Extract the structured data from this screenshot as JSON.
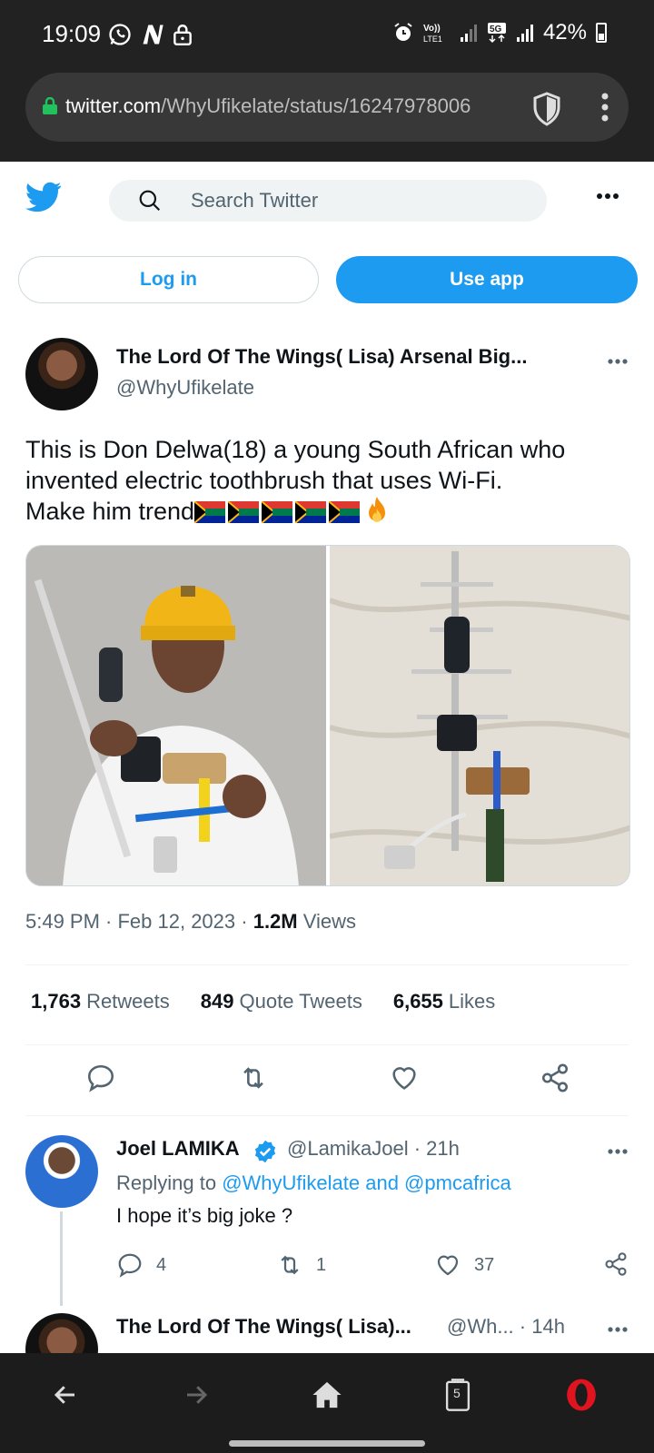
{
  "status_bar": {
    "time": "19:09",
    "battery": "42%",
    "network": "5G"
  },
  "browser": {
    "url_domain": "twitter.com",
    "url_path": "/WhyUfikelate/status/16247978006"
  },
  "header": {
    "search_placeholder": "Search Twitter"
  },
  "auth": {
    "login_label": "Log in",
    "use_app_label": "Use app"
  },
  "tweet": {
    "author_name": "The Lord Of The Wings( Lisa) Arsenal Big...",
    "author_handle": "@WhyUfikelate",
    "text_line1": "This is Don Delwa(18) a young South African who",
    "text_line2": "invented electric toothbrush that uses Wi-Fi.",
    "text_line3": "Make him trend",
    "time": "5:49 PM · Feb 12, 2023 · ",
    "views_count": "1.2M",
    "views_label": " Views",
    "retweets_count": "1,763",
    "retweets_label": "Retweets",
    "quotes_count": "849",
    "quotes_label": "Quote Tweets",
    "likes_count": "6,655",
    "likes_label": "Likes"
  },
  "reply": {
    "name": "Joel LAMIKA",
    "handle_time": "@LamikaJoel · 21h",
    "replying_prefix": "Replying to ",
    "replying_to": "@WhyUfikelate and @pmcafrica",
    "text": "I hope it’s big joke ?",
    "reply_count": "4",
    "retweet_count": "1",
    "like_count": "37"
  },
  "reply2": {
    "name": "The Lord Of The Wings( Lisa)...",
    "handle_time": "@Wh... · 14h"
  },
  "nav": {
    "tab_count": "5"
  },
  "colors": {
    "twitter_blue": "#1d9bf0",
    "text_primary": "#0f1419",
    "text_secondary": "#536471",
    "opera_red": "#e0141e"
  }
}
